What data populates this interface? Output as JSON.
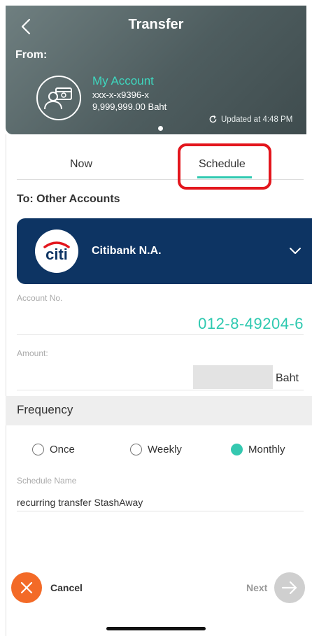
{
  "header": {
    "title": "Transfer",
    "from_label": "From:",
    "account": {
      "name": "My Account",
      "number": "xxx-x-x9396-x",
      "balance": "9,999,999.00 Baht"
    },
    "updated_text": "Updated at 4:48 PM"
  },
  "tabs": [
    {
      "label": "Now",
      "active": false
    },
    {
      "label": "Schedule",
      "active": true
    }
  ],
  "to_label": "To: Other Accounts",
  "bank": {
    "name": "Citibank N.A.",
    "logo_text": "citi",
    "color": "#0d3463"
  },
  "account_field": {
    "label": "Account No.",
    "value": "012-8-49204-6"
  },
  "amount_field": {
    "label": "Amount:",
    "value": "",
    "unit": "Baht"
  },
  "frequency": {
    "label": "Frequency",
    "options": [
      {
        "label": "Once",
        "selected": false
      },
      {
        "label": "Weekly",
        "selected": false
      },
      {
        "label": "Monthly",
        "selected": true
      }
    ]
  },
  "schedule_name": {
    "label": "Schedule Name",
    "value": "recurring transfer StashAway"
  },
  "footer": {
    "cancel_label": "Cancel",
    "next_label": "Next"
  },
  "colors": {
    "accent": "#2ec9b0",
    "cancel": "#f36a27",
    "highlight": "#e3161d"
  }
}
